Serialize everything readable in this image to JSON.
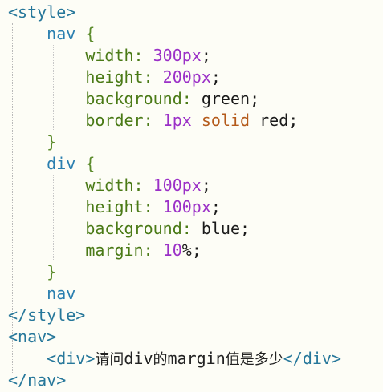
{
  "lines": [
    {
      "text": "<style>"
    },
    {
      "text": "nav {"
    },
    {
      "text": "width: 300px;"
    },
    {
      "text": "height: 200px;"
    },
    {
      "text": "background: green;"
    },
    {
      "text": "border: 1px solid red;"
    },
    {
      "text": "}"
    },
    {
      "text": "div {"
    },
    {
      "text": "width: 100px;"
    },
    {
      "text": "height: 100px;"
    },
    {
      "text": "background: blue;"
    },
    {
      "text": "margin: 10%;"
    },
    {
      "text": "}"
    },
    {
      "text": "nav"
    },
    {
      "text": "</style>"
    },
    {
      "text": "<nav>"
    },
    {
      "text": "<div>请问div的margin值是多少</div>"
    },
    {
      "text": "</nav>"
    }
  ],
  "tokens": {
    "style_open": "<style>",
    "nav_selector": "nav",
    "brace_open": "{",
    "brace_close": "}",
    "width_prop": "width",
    "height_prop": "height",
    "background_prop": "background",
    "border_prop": "border",
    "margin_prop": "margin",
    "colon": ":",
    "semicolon": ";",
    "nav_width_num": "300",
    "nav_height_num": "200",
    "px": "px",
    "green": "green",
    "border_num": "1",
    "solid": "solid",
    "red": "red",
    "div_selector": "div",
    "div_width_num": "100",
    "div_height_num": "100",
    "blue": "blue",
    "margin_num": "10",
    "percent": "%",
    "nav_stray": "nav",
    "style_close": "</style>",
    "nav_open": "<nav>",
    "div_open": "<div>",
    "question_prefix": "请问",
    "question_div": "div",
    "question_mid": "的",
    "question_margin": "margin",
    "question_suffix": "值是多少",
    "div_close": "</div>",
    "nav_close": "</nav>"
  }
}
